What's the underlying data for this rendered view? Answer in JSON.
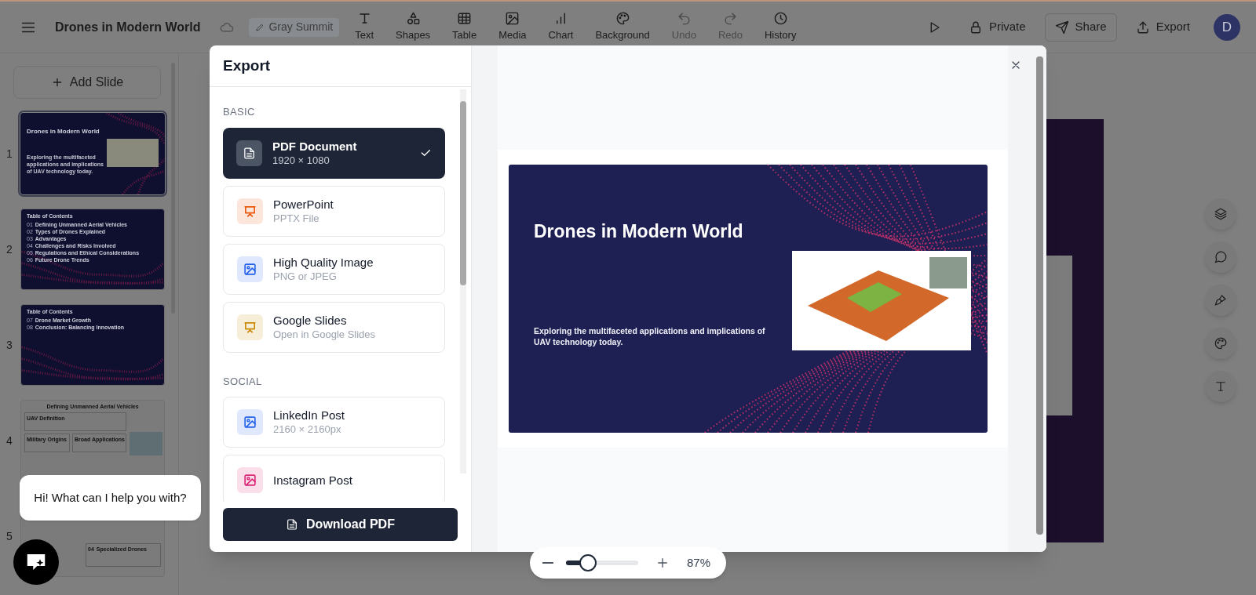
{
  "topbar": {
    "title": "Drones in Modern World",
    "workspace": "Gray Summit",
    "tools": [
      {
        "label": "Text",
        "disabled": false
      },
      {
        "label": "Shapes",
        "disabled": false
      },
      {
        "label": "Table",
        "disabled": false
      },
      {
        "label": "Media",
        "disabled": false
      },
      {
        "label": "Chart",
        "disabled": false
      },
      {
        "label": "Background",
        "disabled": false
      },
      {
        "label": "Undo",
        "disabled": true
      },
      {
        "label": "Redo",
        "disabled": true
      },
      {
        "label": "History",
        "disabled": false
      }
    ],
    "actions": [
      {
        "label": "Private",
        "kind": "plain"
      },
      {
        "label": "Share",
        "kind": "outlined"
      },
      {
        "label": "Export",
        "kind": "plain"
      }
    ],
    "avatar": "D"
  },
  "sidebar": {
    "add_button": "Add Slide",
    "slides": [
      {
        "number": "1",
        "selected": true,
        "kind": "title",
        "title": "Drones in Modern World",
        "subtitle": "Exploring the multifaceted applications and implications of UAV technology today."
      },
      {
        "number": "2",
        "selected": false,
        "kind": "toc",
        "title": "Table of Contents",
        "items": [
          {
            "num": "01",
            "text": "Defining Unmanned Aerial Vehicles"
          },
          {
            "num": "02",
            "text": "Types of Drones Explained"
          },
          {
            "num": "03",
            "text": "Advantages"
          },
          {
            "num": "04",
            "text": "Challenges and Risks Involved"
          },
          {
            "num": "05",
            "text": "Regulations and Ethical Considerations"
          },
          {
            "num": "06",
            "text": "Future Drone Trends"
          }
        ]
      },
      {
        "number": "3",
        "selected": false,
        "kind": "toc",
        "title": "Table of Contents",
        "items": [
          {
            "num": "07",
            "text": "Drone Market Growth"
          },
          {
            "num": "08",
            "text": "Conclusion: Balancing Innovation"
          }
        ]
      },
      {
        "number": "4",
        "selected": false,
        "kind": "content",
        "title": "Defining Unmanned Aerial Vehicles",
        "items": [
          {
            "text": "UAV Definition"
          },
          {
            "text": "Military Origins"
          },
          {
            "text": "Broad Applications"
          }
        ]
      },
      {
        "number": "5",
        "selected": false,
        "kind": "grid",
        "items": [
          {
            "num": "04",
            "text": "Specialized Drones"
          }
        ]
      }
    ]
  },
  "export_dialog": {
    "title": "Export",
    "sections": [
      {
        "heading": "BASIC",
        "options": [
          {
            "title": "PDF Document",
            "subtitle": "1920 × 1080",
            "kind": "document",
            "color": "#4b5563",
            "selected": true
          },
          {
            "title": "PowerPoint",
            "subtitle": "PPTX File",
            "kind": "presentation",
            "color": "#ea580c",
            "selected": false
          },
          {
            "title": "High Quality Image",
            "subtitle": "PNG or JPEG",
            "kind": "image",
            "color": "#2563eb",
            "selected": false
          },
          {
            "title": "Google Slides",
            "subtitle": "Open in Google Slides",
            "kind": "presentation",
            "color": "#ca8a04",
            "selected": false
          }
        ]
      },
      {
        "heading": "SOCIAL",
        "options": [
          {
            "title": "LinkedIn Post",
            "subtitle": "2160 × 2160px",
            "kind": "image",
            "color": "#2563eb",
            "selected": false
          },
          {
            "title": "Instagram Post",
            "kind": "image",
            "color": "#db2777",
            "selected": false
          }
        ]
      }
    ],
    "download_button": "Download PDF",
    "preview": {
      "title": "Drones in Modern World",
      "subtitle": "Exploring the multifaceted applications and implications of UAV technology today."
    }
  },
  "zoom": {
    "level": 0.3,
    "reading": "87%"
  },
  "chat": {
    "message": "Hi! What can I help you with?"
  }
}
